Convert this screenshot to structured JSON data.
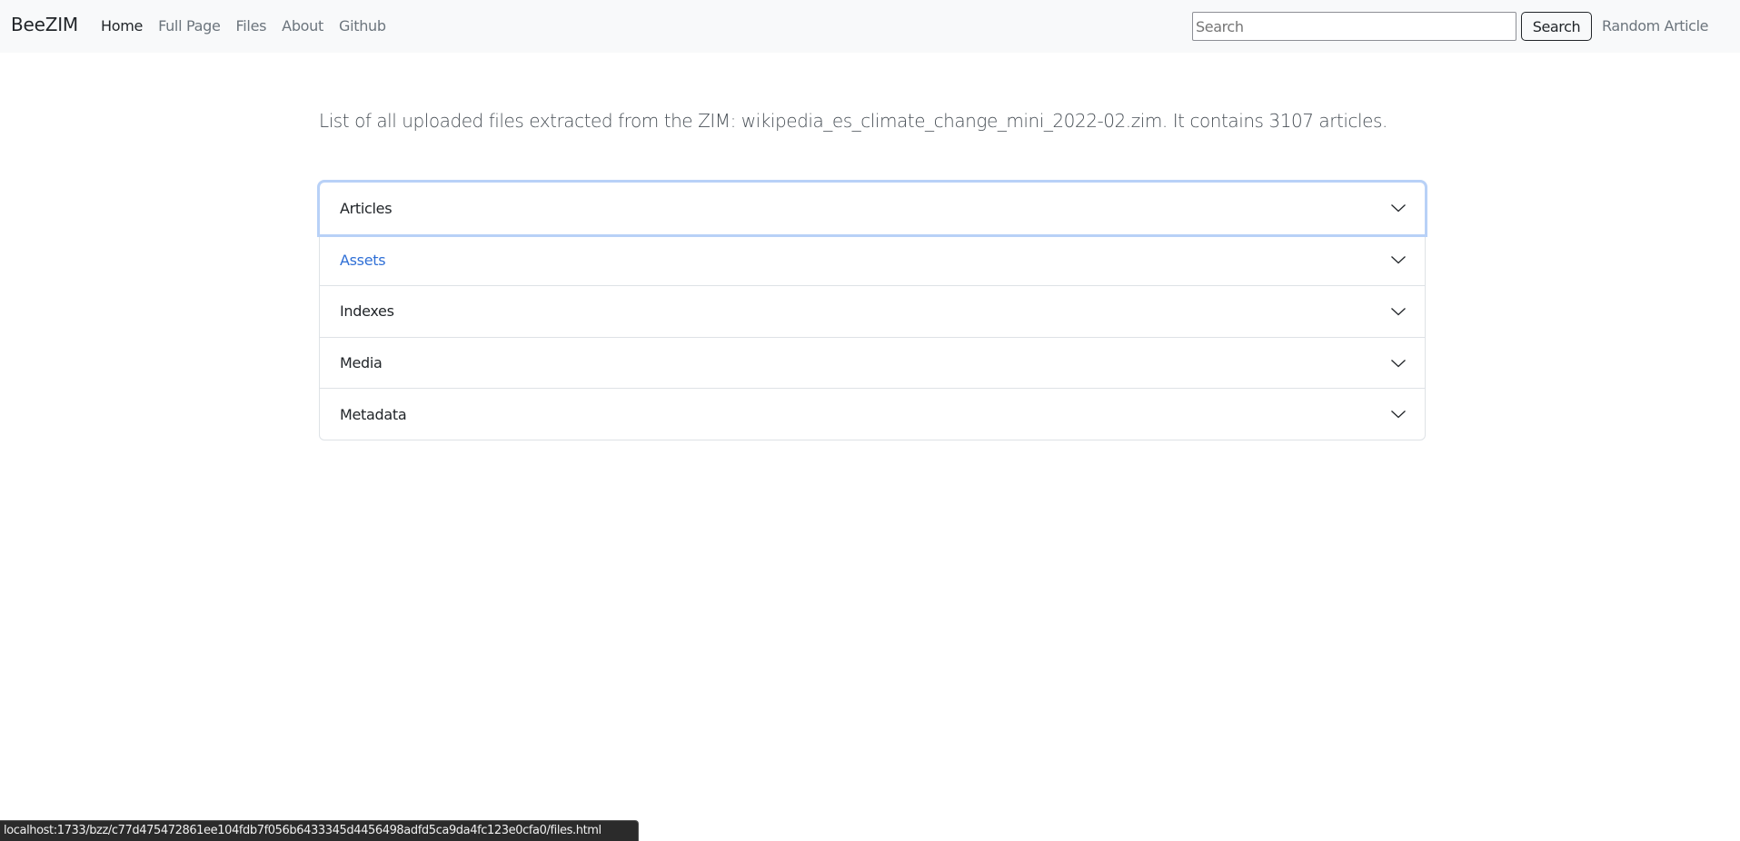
{
  "navbar": {
    "brand": "BeeZIM",
    "links": [
      {
        "label": "Home",
        "active": true
      },
      {
        "label": "Full Page",
        "active": false
      },
      {
        "label": "Files",
        "active": false
      },
      {
        "label": "About",
        "active": false
      },
      {
        "label": "Github",
        "active": false
      }
    ],
    "search": {
      "placeholder": "Search",
      "value": "",
      "button_label": "Search"
    },
    "random_article_label": "Random Article"
  },
  "main": {
    "intro": "List of all uploaded files extracted from the ZIM: wikipedia_es_climate_change_mini_2022-02.zim. It contains 3107 articles.",
    "accordion": [
      {
        "label": "Articles",
        "state": "focused",
        "icon": "chevron-down-icon"
      },
      {
        "label": "Assets",
        "state": "hover",
        "icon": "chevron-down-icon"
      },
      {
        "label": "Indexes",
        "state": "collapsed",
        "icon": "chevron-down-icon"
      },
      {
        "label": "Media",
        "state": "collapsed",
        "icon": "chevron-down-icon"
      },
      {
        "label": "Metadata",
        "state": "collapsed",
        "icon": "chevron-down-icon"
      }
    ]
  },
  "status_bar": {
    "url": "localhost:1733/bzz/c77d475472861ee104fdb7f056b6433345d4456498adfd5ca9da4fc123e0cfa0/files.html"
  },
  "colors": {
    "navbar_bg": "#f8f9fa",
    "link_hover": "#2f6fd6",
    "focus_ring": "#b8d1f7",
    "muted_text": "#6c757d"
  }
}
